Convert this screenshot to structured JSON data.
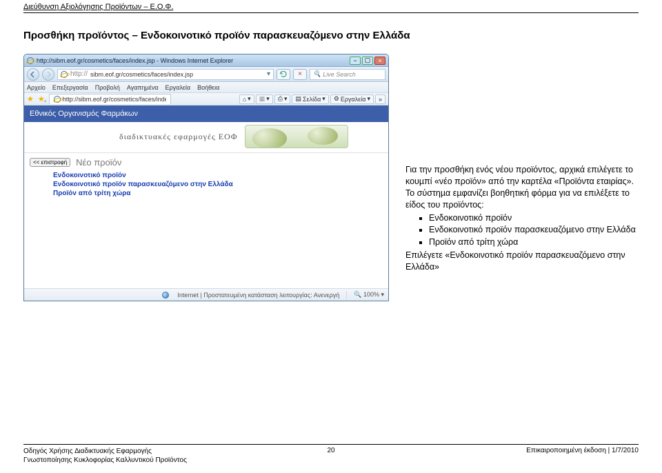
{
  "header": "Διεύθυνση Αξιολόγησης Προϊόντων – Ε.Ο.Φ.",
  "page_title": "Προσθήκη προϊόντος – Ενδοκοινοτικό προϊόν παρασκευαζόµενο στην Ελλάδα",
  "browser": {
    "title": "http://sibm.eof.gr/cosmetics/faces/index.jsp - Windows Internet Explorer",
    "url_prefix": "http://",
    "url": "sibm.eof.gr/cosmetics/faces/index.jsp",
    "search_placeholder": "Live Search",
    "menus": [
      "Αρχείο",
      "Επεξεργασία",
      "Προβολή",
      "Αγαπημένα",
      "Εργαλεία",
      "Βοήθεια"
    ],
    "tab_label": "http://sibm.eof.gr/cosmetics/faces/index.jsp",
    "toolbar": {
      "page_label": "Σελίδα",
      "tools_label": "Εργαλεία"
    },
    "org_name": "Εθνικός Οργανισμός Φαρμάκων",
    "apps_label": "διαδικτυακές εφαρμογές ΕΟΦ",
    "back_btn": "<< επιστροφή",
    "section_title": "Νέο προϊόν",
    "links": [
      "Ενδοκοινοτικό προϊόν",
      "Ενδοκοινοτικό προϊόν παρασκευαζόμενο στην Ελλάδα",
      "Προϊόν από τρίτη χώρα"
    ],
    "status": {
      "zone": "Internet | Προστατευμένη κατάσταση λειτουργίας: Ανενεργή",
      "zoom": "100%"
    }
  },
  "body_text": {
    "p1": "Για την προσθήκη ενός νέου προϊόντος, αρχικά επιλέγετε το κουµπί «νέο προϊόν» από την καρτέλα «Προϊόντα εταιρίας». Το σύστηµα εµφανίζει βοηθητική φόρµα για να επιλέξετε το είδος του προϊόντος:",
    "bullets": [
      "Ενδοκοινοτικό προϊόν",
      "Ενδοκοινοτικό προϊόν παρασκευαζόµενο στην Ελλάδα",
      "Προϊόν από τρίτη χώρα"
    ],
    "p2": "Επιλέγετε «Ενδοκοινοτικό προϊόν παρασκευαζόµενο στην Ελλάδα»"
  },
  "footer": {
    "left1": "Οδηγός Χρήσης ∆ιαδικτυακής Εφαρµογής",
    "left2": "Γνωστοποίησης Κυκλοφορίας Καλλυντικού Προϊόντος",
    "page_no": "20",
    "right": "Επικαιροποιηµένη έκδοση | 1/7/2010"
  }
}
